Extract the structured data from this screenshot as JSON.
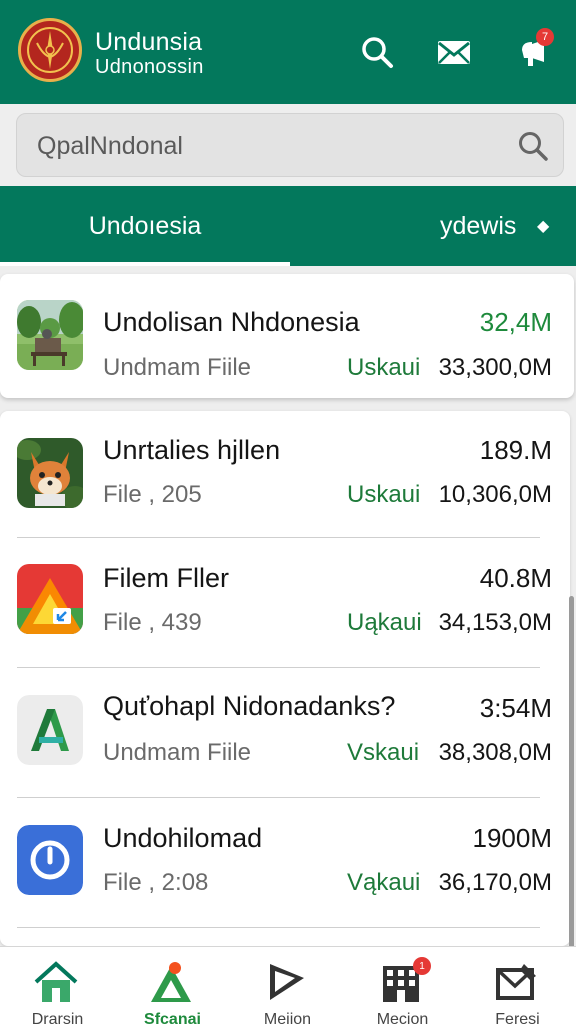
{
  "colors": {
    "primary": "#03785c",
    "accent_green": "#1e8a3c",
    "badge_red": "#e53935",
    "background": "#eeeeee"
  },
  "header": {
    "title": "Undunsia",
    "subtitle": "Udnonossin",
    "icons": [
      "search-icon",
      "mail-icon",
      "notification-icon"
    ],
    "notification_badge": "7"
  },
  "search": {
    "placeholder": "QpalNndonal",
    "icon": "search-icon"
  },
  "tabs": [
    {
      "label": "Undoıesia",
      "active": true
    },
    {
      "label": "ydewis",
      "active": false,
      "icon": "dropdown-icon"
    }
  ],
  "list": [
    {
      "name": "Undolisan Nhdonesia",
      "sub": "Undmam Fiile",
      "size": "32,4M",
      "tag": "Uskaui",
      "downloads": "33,300,0M",
      "icon": "garden-photo-icon",
      "size_green": true
    },
    {
      "name": "Unrtalies hjllen",
      "sub": "File , 205",
      "size": "189.M",
      "tag": "Uskaui",
      "downloads": "10,306,0M",
      "icon": "fox-icon",
      "size_green": false
    },
    {
      "name": "Filem Fller",
      "sub": "File , 439",
      "size": "40.8M",
      "tag": "Uąkaui",
      "downloads": "34,153,0M",
      "icon": "drive-icon",
      "size_green": false
    },
    {
      "name": "Quťohарl Nidonadanks?",
      "sub": "Undmam Fiile",
      "size": "3:54M",
      "tag": "Vskaui",
      "downloads": "38,308,0M",
      "icon": "green-a-icon",
      "size_green": false
    },
    {
      "name": "Undohilomad",
      "sub": "File , 2:08",
      "size": "1900M",
      "tag": "Vąkaui",
      "downloads": "36,170,0M",
      "icon": "clock-icon",
      "size_green": false
    }
  ],
  "bottom_nav": [
    {
      "label": "Drarsin",
      "icon": "home-icon",
      "active": false
    },
    {
      "label": "Sfcanai",
      "icon": "map-pin-icon",
      "active": true
    },
    {
      "label": "Mejion",
      "icon": "send-icon",
      "active": false
    },
    {
      "label": "Mecion",
      "icon": "store-icon",
      "active": false,
      "badge": "1"
    },
    {
      "label": "Feresi",
      "icon": "compose-icon",
      "active": false
    }
  ]
}
